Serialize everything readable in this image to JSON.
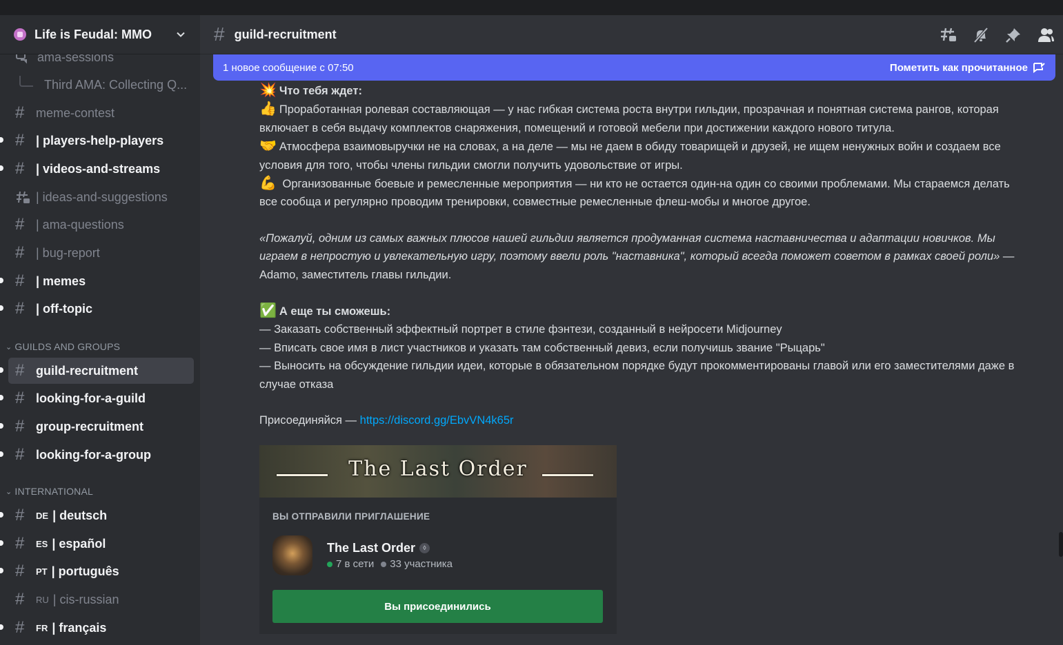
{
  "server": {
    "name": "Life is Feudal: MMO"
  },
  "sidebar": {
    "channels_top": [
      {
        "name": "ama-sessions",
        "kind": "forum",
        "unread": false
      },
      {
        "name": "Third AMA: Collecting Q...",
        "kind": "thread",
        "unread": false
      },
      {
        "name": "meme-contest",
        "kind": "text",
        "unread": false
      },
      {
        "name": "| players-help-players",
        "kind": "text",
        "unread": true
      },
      {
        "name": "| videos-and-streams",
        "kind": "text",
        "unread": true
      },
      {
        "name": "| ideas-and-suggestions",
        "kind": "forum",
        "unread": false
      },
      {
        "name": "| ama-questions",
        "kind": "text",
        "unread": false
      },
      {
        "name": "| bug-report",
        "kind": "text",
        "unread": false
      },
      {
        "name": "| memes",
        "kind": "text",
        "unread": true
      },
      {
        "name": "| off-topic",
        "kind": "text",
        "unread": true
      }
    ],
    "category_guilds": "GUILDS AND GROUPS",
    "channels_guilds": [
      {
        "name": "guild-recruitment",
        "active": true,
        "unread": true
      },
      {
        "name": "looking-for-a-guild",
        "unread": true
      },
      {
        "name": "group-recruitment",
        "unread": true
      },
      {
        "name": "looking-for-a-group",
        "unread": true
      }
    ],
    "category_international": "INTERNATIONAL",
    "channels_international": [
      {
        "tag": "DE",
        "name": "| deutsch",
        "unread": true
      },
      {
        "tag": "ES",
        "name": "| español",
        "unread": true
      },
      {
        "tag": "PT",
        "name": "| português",
        "unread": true
      },
      {
        "tag": "RU",
        "name": "| cis-russian",
        "unread": false
      },
      {
        "tag": "FR",
        "name": "| français",
        "unread": true
      }
    ]
  },
  "header": {
    "channel": "guild-recruitment"
  },
  "banner": {
    "text": "1 новое сообщение с 07:50",
    "mark_read": "Пометить как прочитанное"
  },
  "message": {
    "heading1": "Что тебя ждет:",
    "p1": "Проработанная ролевая составляющая — у нас гибкая система роста внутри гильдии, прозрачная и понятная система рангов, которая включает в себя выдачу комплектов снаряжения, помещений и готовой мебели при достижении каждого нового титула.",
    "p2": "Атмосфера взаимовыручки не на словах, а на деле — мы не даем в обиду товарищей и друзей, не ищем ненужных войн и создаем все условия для того, чтобы члены гильдии смогли получить удовольствие от игры.",
    "p3": " Организованные боевые и ремесленные мероприятия — ни кто не остается один-на один со своими проблемами. Мы стараемся делать все сообща и регулярно проводим тренировки, совместные ремесленные флеш-мобы и многое другое.",
    "quote": "«Пожалуй, одним из самых важных плюсов нашей гильдии является продуманная система наставничества и адаптации новичков. Мы играем в непростую и увлекательную игру, поэтому ввели роль \"наставника\", который всегда поможет советом в рамках своей роли»",
    "quote_author": " — Adamo, заместитель главы гильдии.",
    "heading2": "А еще ты сможешь:",
    "list1": "— Заказать собственный эффектный портрет в стиле фэнтези, созданный в нейросети Midjourney",
    "list2": "— Вписать свое имя в лист участников и указать там собственный девиз, если получишь звание \"Рыцарь\"",
    "list3": "— Выносить на обсуждение гильдии идеи, которые в обязательном порядке будут прокомментированы главой или его заместителями даже в случае отказа",
    "join_prefix": "Присоединяйся — ",
    "join_link": "https://discord.gg/EbvVN4k65r"
  },
  "invite": {
    "banner_title": "The Last Order",
    "heading": "ВЫ ОТПРАВИЛИ ПРИГЛАШЕНИЕ",
    "guild_name": "The Last Order",
    "online": "7 в сети",
    "members": "33 участника",
    "button": "Вы присоединились"
  },
  "colors": {
    "accent": "#5865f2",
    "join_green": "#248046",
    "link": "#00a8fc",
    "online": "#23a55a"
  }
}
